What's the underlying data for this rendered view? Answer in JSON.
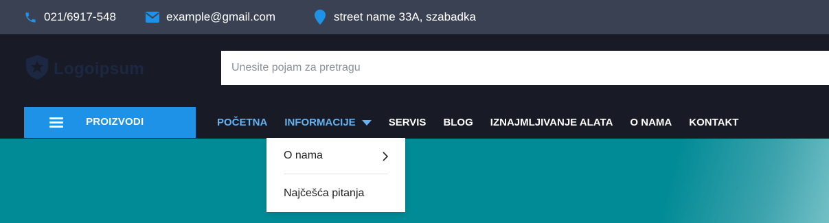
{
  "topbar": {
    "phone": "021/6917-548",
    "email": "example@gmail.com",
    "address": "street name 33A, szabadka",
    "icons": [
      "phone-icon",
      "mail-icon",
      "location-pin-icon"
    ],
    "icon_color": "#1d92e6"
  },
  "header": {
    "logo_text": "Logoipsum",
    "search_placeholder": "Unesite pojam za pretragu"
  },
  "nav": {
    "products_label": "PROIZVODI",
    "items": [
      {
        "label": "POČETNA"
      },
      {
        "label": "INFORMACIJE"
      },
      {
        "label": "SERVIS"
      },
      {
        "label": "BLOG"
      },
      {
        "label": "IZNAJMLJIVANJE ALATA"
      },
      {
        "label": "O NAMA"
      },
      {
        "label": "KONTAKT"
      }
    ]
  },
  "dropdown": {
    "items": [
      {
        "label": "O nama"
      },
      {
        "label": "Najčešća pitanja"
      }
    ]
  },
  "colors": {
    "topbar_bg": "#3a4152",
    "header_bg": "#181b25",
    "accent": "#1d92e6",
    "nav_active": "#64b2f2",
    "hero": "#018b96"
  }
}
